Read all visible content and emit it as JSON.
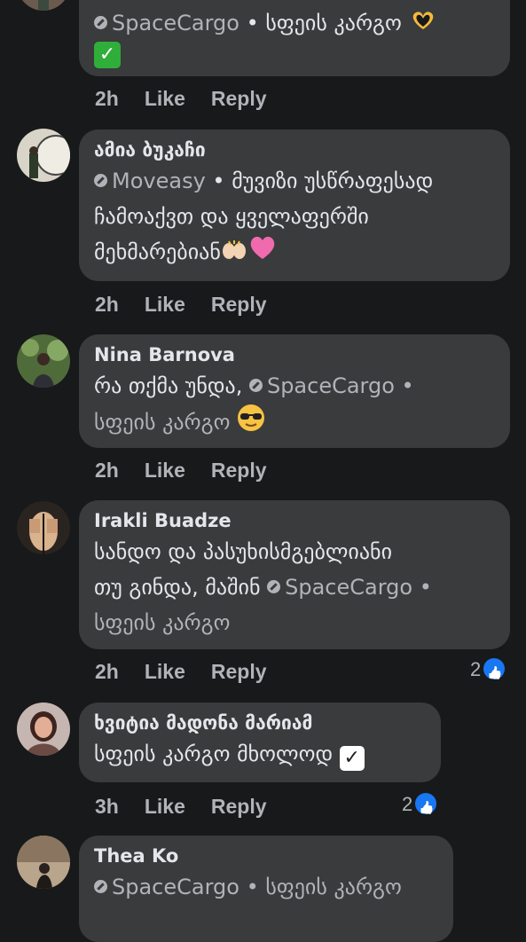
{
  "tag_name": "SpaceCargo",
  "comments": [
    {
      "line1_tag": "SpaceCargo",
      "line1_suffix": " • სფეის კარგო",
      "time": "2h",
      "like": "Like",
      "reply": "Reply"
    },
    {
      "author": "ამია ბუკაჩი",
      "tag": "Moveasy",
      "line1_suffix": " • მუვიზი უსწრაფესად",
      "line2": "ჩამოაქვთ და ყველაფერში",
      "line3": "მეხმარებიან",
      "time": "2h",
      "like": "Like",
      "reply": "Reply"
    },
    {
      "author": "Nina Barnova",
      "line1_prefix": "რა თქმა უნდა, ",
      "tag": "SpaceCargo",
      "line1_suffix": " •",
      "line2": "სფეის კარგო",
      "time": "2h",
      "like": "Like",
      "reply": "Reply"
    },
    {
      "author": "Irakli Buadze",
      "line1": "სანდო და პასუხისმგებლიანი",
      "line2_prefix": "თუ გინდა, მაშინ ",
      "tag": "SpaceCargo",
      "line2_suffix": " •",
      "line3": "სფეის კარგო",
      "time": "2h",
      "like": "Like",
      "reply": "Reply",
      "reactions": "2"
    },
    {
      "author": "ხვიტია მადონა მარიამ",
      "line1": "სფეის კარგო მხოლოდ",
      "time": "3h",
      "like": "Like",
      "reply": "Reply",
      "reactions": "2"
    },
    {
      "author": "Thea Ko",
      "tag": "SpaceCargo",
      "line1_suffix": " • სფეის კარგო"
    }
  ],
  "colors": {
    "background": "#18191a",
    "bubble": "#3a3b3c",
    "like_blue": "#1877f2"
  }
}
